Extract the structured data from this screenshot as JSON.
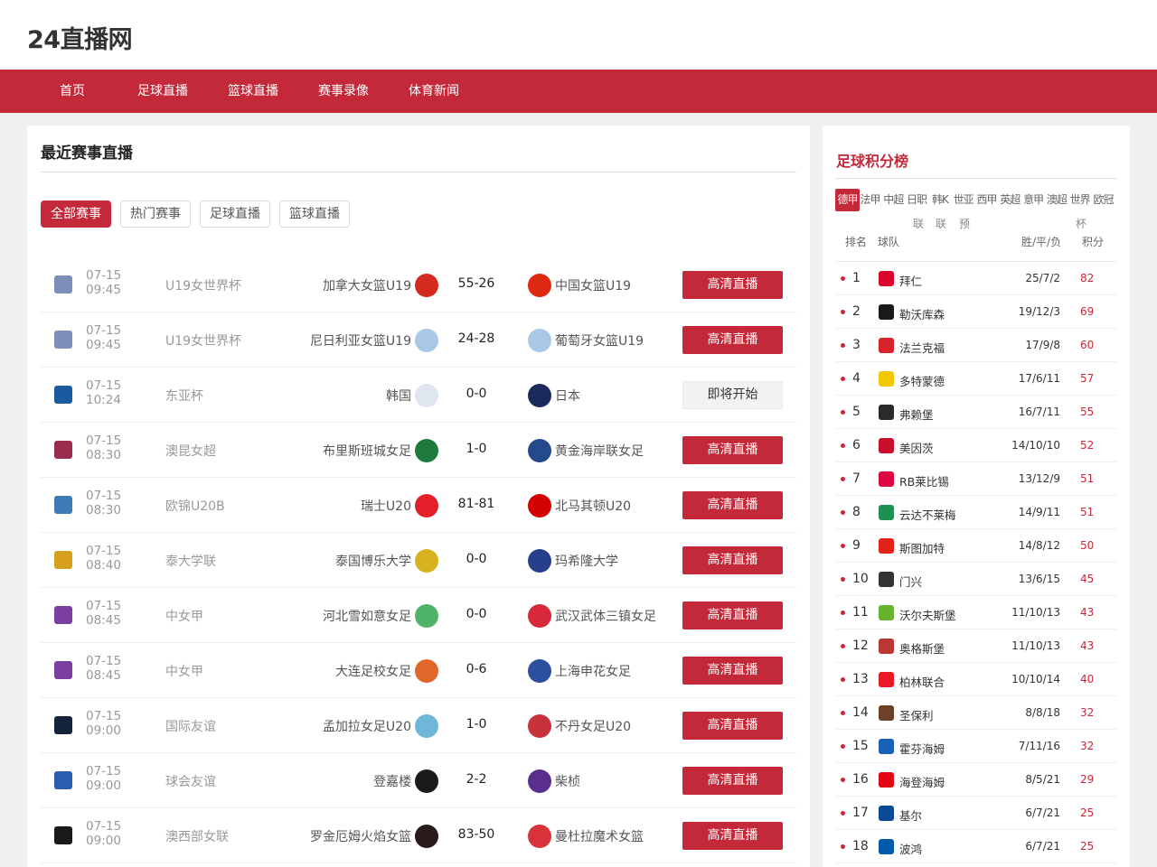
{
  "site": {
    "title": "24直播网"
  },
  "nav": [
    "首页",
    "足球直播",
    "篮球直播",
    "赛事录像",
    "体育新闻"
  ],
  "main": {
    "title": "最近赛事直播",
    "filters": [
      "全部赛事",
      "热门赛事",
      "足球直播",
      "篮球直播"
    ],
    "active_filter": 0,
    "matches": [
      {
        "date": "07-15",
        "time": "09:45",
        "league": "U19女世界杯",
        "home": "加拿大女篮U19",
        "score": "55-26",
        "away": "中国女篮U19",
        "button": "高清直播",
        "status": "live",
        "league_color": "#7d8fb8",
        "home_color": "#d52b1e",
        "away_color": "#de2910"
      },
      {
        "date": "07-15",
        "time": "09:45",
        "league": "U19女世界杯",
        "home": "尼日利亚女篮U19",
        "score": "24-28",
        "away": "葡萄牙女篮U19",
        "button": "高清直播",
        "status": "live",
        "league_color": "#7d8fb8",
        "home_color": "#a9c7e6",
        "away_color": "#a9c7e6"
      },
      {
        "date": "07-15",
        "time": "10:24",
        "league": "东亚杯",
        "home": "韩国",
        "score": "0-0",
        "away": "日本",
        "button": "即将开始",
        "status": "soon",
        "league_color": "#1c5aa0",
        "home_color": "#dfe6ef",
        "away_color": "#1a2a5a"
      },
      {
        "date": "07-15",
        "time": "08:30",
        "league": "澳昆女超",
        "home": "布里斯班城女足",
        "score": "1-0",
        "away": "黄金海岸联女足",
        "button": "高清直播",
        "status": "live",
        "league_color": "#9b2c4d",
        "home_color": "#1e7a3c",
        "away_color": "#244a8c"
      },
      {
        "date": "07-15",
        "time": "08:30",
        "league": "欧锦U20B",
        "home": "瑞士U20",
        "score": "81-81",
        "away": "北马其顿U20",
        "button": "高清直播",
        "status": "live",
        "league_color": "#3e7cb8",
        "home_color": "#e4202b",
        "away_color": "#d20000"
      },
      {
        "date": "07-15",
        "time": "08:40",
        "league": "泰大学联",
        "home": "泰国博乐大学",
        "score": "0-0",
        "away": "玛希隆大学",
        "button": "高清直播",
        "status": "live",
        "league_color": "#d6a21e",
        "home_color": "#d8b21e",
        "away_color": "#27408b"
      },
      {
        "date": "07-15",
        "time": "08:45",
        "league": "中女甲",
        "home": "河北雪如意女足",
        "score": "0-0",
        "away": "武汉武体三镇女足",
        "button": "高清直播",
        "status": "live",
        "league_color": "#7b3fa0",
        "home_color": "#4fb36a",
        "away_color": "#d8293a"
      },
      {
        "date": "07-15",
        "time": "08:45",
        "league": "中女甲",
        "home": "大连足校女足",
        "score": "0-6",
        "away": "上海申花女足",
        "button": "高清直播",
        "status": "live",
        "league_color": "#7b3fa0",
        "home_color": "#e0662a",
        "away_color": "#2d4fa0"
      },
      {
        "date": "07-15",
        "time": "09:00",
        "league": "国际友谊",
        "home": "孟加拉女足U20",
        "score": "1-0",
        "away": "不丹女足U20",
        "button": "高清直播",
        "status": "live",
        "league_color": "#14243a",
        "home_color": "#6fb6d8",
        "away_color": "#c8323a"
      },
      {
        "date": "07-15",
        "time": "09:00",
        "league": "球会友谊",
        "home": "登嘉楼",
        "score": "2-2",
        "away": "柴桢",
        "button": "高清直播",
        "status": "live",
        "league_color": "#2a5cb0",
        "home_color": "#1a1a1a",
        "away_color": "#5a2e8c"
      },
      {
        "date": "07-15",
        "time": "09:00",
        "league": "澳西部女联",
        "home": "罗金厄姆火焰女篮",
        "score": "83-50",
        "away": "曼杜拉魔术女篮",
        "button": "高清直播",
        "status": "live",
        "league_color": "#1a1a1a",
        "home_color": "#2a1a1a",
        "away_color": "#d8323a"
      }
    ]
  },
  "side": {
    "title": "足球积分榜",
    "leagues": [
      "德甲",
      "法甲",
      "中超",
      "日职",
      "韩K",
      "世亚",
      "西甲",
      "英超",
      "意甲",
      "澳超",
      "世界",
      "欧冠"
    ],
    "active_league": 0,
    "extra_labels": [
      "联",
      "联",
      "预",
      "杯"
    ],
    "headers": {
      "rank": "排名",
      "team": "球队",
      "record": "胜/平/负",
      "points": "积分"
    },
    "rows": [
      {
        "rank": "1",
        "team": "拜仁",
        "record": "25/7/2",
        "points": "82",
        "color": "#dc052d"
      },
      {
        "rank": "2",
        "team": "勒沃库森",
        "record": "19/12/3",
        "points": "69",
        "color": "#1a1a1a"
      },
      {
        "rank": "3",
        "team": "法兰克福",
        "record": "17/9/8",
        "points": "60",
        "color": "#d8232a"
      },
      {
        "rank": "4",
        "team": "多特蒙德",
        "record": "17/6/11",
        "points": "57",
        "color": "#f0c800"
      },
      {
        "rank": "5",
        "team": "弗赖堡",
        "record": "16/7/11",
        "points": "55",
        "color": "#2a2a2a"
      },
      {
        "rank": "6",
        "team": "美因茨",
        "record": "14/10/10",
        "points": "52",
        "color": "#c8102e"
      },
      {
        "rank": "7",
        "team": "RB莱比锡",
        "record": "13/12/9",
        "points": "51",
        "color": "#dd0741"
      },
      {
        "rank": "8",
        "team": "云达不莱梅",
        "record": "14/9/11",
        "points": "51",
        "color": "#1d9053"
      },
      {
        "rank": "9",
        "team": "斯图加特",
        "record": "14/8/12",
        "points": "50",
        "color": "#e32219"
      },
      {
        "rank": "10",
        "team": "门兴",
        "record": "13/6/15",
        "points": "45",
        "color": "#333333"
      },
      {
        "rank": "11",
        "team": "沃尔夫斯堡",
        "record": "11/10/13",
        "points": "43",
        "color": "#65b32e"
      },
      {
        "rank": "12",
        "team": "奥格斯堡",
        "record": "11/10/13",
        "points": "43",
        "color": "#ba3733"
      },
      {
        "rank": "13",
        "team": "柏林联合",
        "record": "10/10/14",
        "points": "40",
        "color": "#eb1923"
      },
      {
        "rank": "14",
        "team": "圣保利",
        "record": "8/8/18",
        "points": "32",
        "color": "#6b4226"
      },
      {
        "rank": "15",
        "team": "霍芬海姆",
        "record": "7/11/16",
        "points": "32",
        "color": "#1961b5"
      },
      {
        "rank": "16",
        "team": "海登海姆",
        "record": "8/5/21",
        "points": "29",
        "color": "#e30613"
      },
      {
        "rank": "17",
        "team": "基尔",
        "record": "6/7/21",
        "points": "25",
        "color": "#0a4a96"
      },
      {
        "rank": "18",
        "team": "波鸿",
        "record": "6/7/21",
        "points": "25",
        "color": "#005ca9"
      }
    ]
  }
}
